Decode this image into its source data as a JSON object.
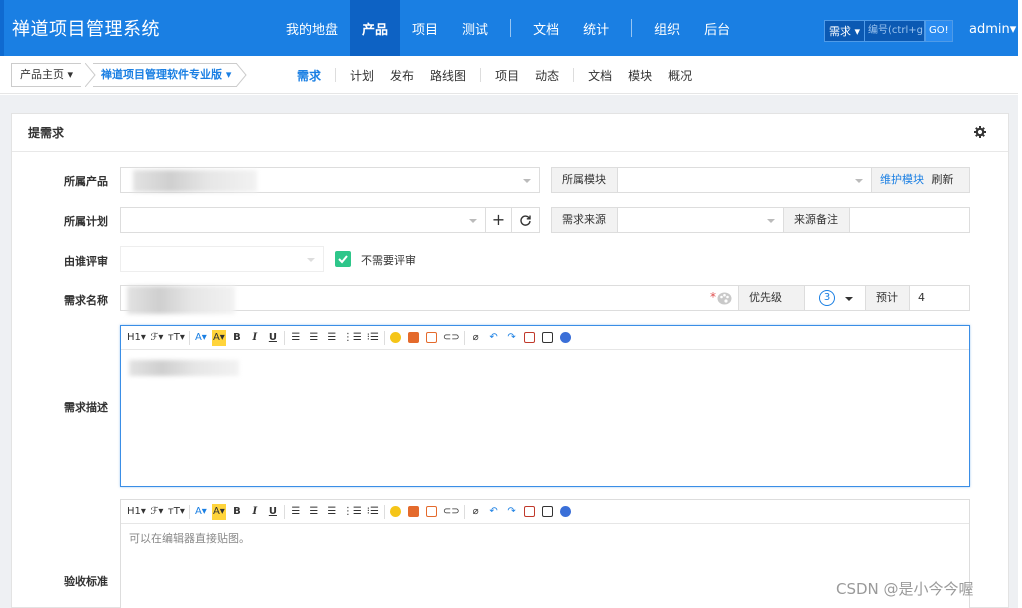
{
  "header": {
    "app_title": "禅道项目管理系统",
    "nav": [
      "我的地盘",
      "产品",
      "项目",
      "测试",
      "文档",
      "统计",
      "组织",
      "后台"
    ],
    "active_nav": "产品",
    "search_type": "需求",
    "search_placeholder": "编号(ctrl+g)",
    "search_go": "GO!",
    "user": "admin"
  },
  "subnav": {
    "crumb_home": "产品主页",
    "crumb_product": "禅道项目管理软件专业版",
    "items": [
      "需求",
      "计划",
      "发布",
      "路线图",
      "项目",
      "动态",
      "文档",
      "模块",
      "概况"
    ],
    "active": "需求"
  },
  "panel": {
    "title": "提需求",
    "labels": {
      "product": "所属产品",
      "plan": "所属计划",
      "reviewer": "由谁评审",
      "name": "需求名称",
      "desc": "需求描述",
      "verify": "验收标准"
    },
    "module_label": "所属模块",
    "maintain_module": "维护模块",
    "refresh": "刷新",
    "source_label": "需求来源",
    "source_note_label": "来源备注",
    "no_review": "不需要评审",
    "priority_label": "优先级",
    "priority_value": "3",
    "estimate_label": "预计",
    "estimate_value": "4",
    "verify_placeholder": "可以在编辑器直接贴图。"
  },
  "toolbar": [
    "H1",
    "ℱ",
    "тT",
    "A",
    "A",
    "B",
    "I",
    "U"
  ],
  "watermark": "CSDN @是小今今喔",
  "colors": {
    "primary": "#1a7fe3",
    "header_active": "#0d62c4",
    "check": "#2ec68a"
  }
}
